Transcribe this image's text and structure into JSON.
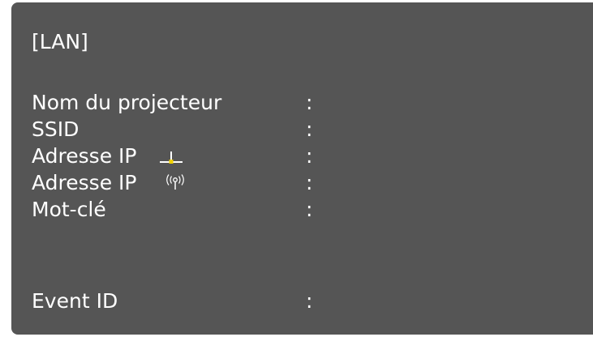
{
  "section_title": "[LAN]",
  "fields": [
    {
      "label": "Nom du projecteur",
      "separator": ":",
      "value": ""
    },
    {
      "label": "SSID",
      "separator": ":",
      "value": ""
    },
    {
      "label": "Adresse IP",
      "icon": "wired-lan-icon",
      "separator": ":",
      "value": ""
    },
    {
      "label": "Adresse IP",
      "icon": "wireless-lan-icon",
      "separator": ":",
      "value": ""
    },
    {
      "label": "Mot-clé",
      "separator": ":",
      "value": ""
    },
    {
      "label": "Event ID",
      "separator": ":",
      "value": ""
    }
  ],
  "colors": {
    "panel_background": "#555555",
    "text": "#ffffff",
    "wired_icon_accent": "#f0d000"
  }
}
